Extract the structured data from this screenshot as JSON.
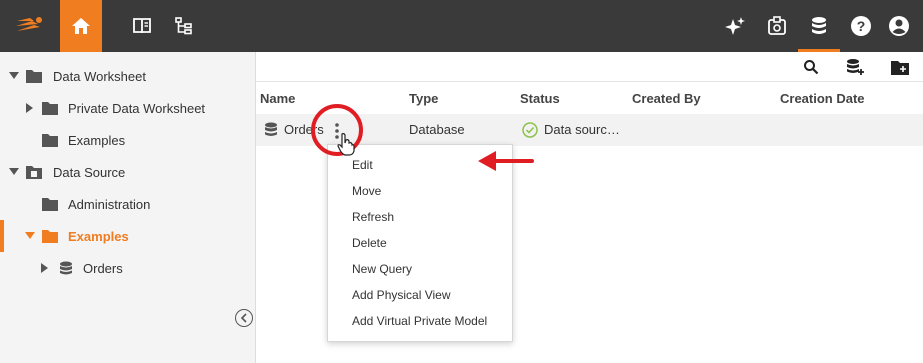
{
  "colors": {
    "accent": "#f07d20",
    "topbar": "#3a3a3a",
    "annotation": "#e11d24",
    "status_ok": "#8bc34a"
  },
  "topbar": {
    "icons": [
      "logo-icon",
      "home-icon",
      "book-icon",
      "hierarchy-icon",
      "sparkle-icon",
      "badge-settings-icon",
      "database-icon",
      "help-icon",
      "account-icon"
    ]
  },
  "sidebar": {
    "items": [
      {
        "label": "Data Worksheet",
        "icon": "folder-icon"
      },
      {
        "label": "Private Data Worksheet",
        "icon": "folder-icon"
      },
      {
        "label": "Examples",
        "icon": "folder-icon"
      },
      {
        "label": "Data Source",
        "icon": "datasource-folder-icon"
      },
      {
        "label": "Administration",
        "icon": "folder-icon"
      },
      {
        "label": "Examples",
        "icon": "folder-icon"
      },
      {
        "label": "Orders",
        "icon": "database-icon"
      }
    ]
  },
  "toolbar": {
    "icons": [
      "search-icon",
      "add-datasource-icon",
      "new-folder-icon"
    ]
  },
  "table": {
    "columns": [
      "Name",
      "Type",
      "Status",
      "Created By",
      "Creation Date"
    ],
    "rows": [
      {
        "name": "Orders",
        "type": "Database",
        "status": "Data sourc…",
        "created_by": "",
        "creation_date": ""
      }
    ]
  },
  "context_menu": {
    "items": [
      "Edit",
      "Move",
      "Refresh",
      "Delete",
      "New Query",
      "Add Physical View",
      "Add Virtual Private Model"
    ]
  }
}
